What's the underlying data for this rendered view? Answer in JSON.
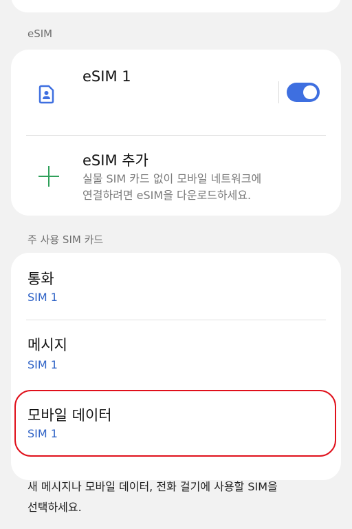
{
  "sections": {
    "esim_header": "eSIM",
    "primary_header": "주 사용 SIM 카드"
  },
  "esim": {
    "item_title": "eSIM 1",
    "toggle_on": true,
    "add_title": "eSIM 추가",
    "add_desc_line1": "실물 SIM 카드 없이 모바일 네트워크에",
    "add_desc_line2": "연결하려면 eSIM을 다운로드하세요."
  },
  "primary_sim": {
    "items": [
      {
        "label": "통화",
        "value": "SIM 1"
      },
      {
        "label": "메시지",
        "value": "SIM 1"
      },
      {
        "label": "모바일 데이터",
        "value": "SIM 1"
      }
    ]
  },
  "footer": {
    "line1": "새 메시지나 모바일 데이터, 전화 걸기에 사용할 SIM을",
    "line2": "선택하세요."
  },
  "colors": {
    "accent": "#3e6fe0",
    "value_text": "#2e62c6",
    "plus": "#2fa05a",
    "highlight": "#e0101b"
  },
  "icons": {
    "sim": "sim-card-icon",
    "add": "plus-icon"
  }
}
